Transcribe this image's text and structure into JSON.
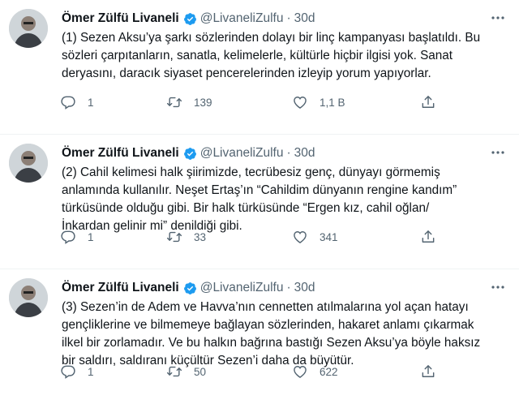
{
  "colors": {
    "verified": "#1d9bf0",
    "text": "#0f1419",
    "secondary": "#536471",
    "divider": "#eff3f4"
  },
  "icons": {
    "verified": "verified-badge-icon",
    "more": "more-horizontal-icon",
    "reply": "reply-icon",
    "retweet": "retweet-icon",
    "like": "heart-icon",
    "share": "share-icon"
  },
  "tweets": [
    {
      "author": "Ömer Zülfü Livaneli",
      "handle": "@LivaneliZulfu",
      "separator": "·",
      "time": "30d",
      "text": "(1) Sezen Aksu’ya şarkı sözlerinden dolayı bir linç kampanyası başlatıldı.  Bu\nsözleri çarpıtanların, sanatla, kelimelerle, kültürle hiçbir ilgisi yok. Sanat\nderyasını, daracık siyaset pencerelerinden izleyip yorum yapıyorlar.",
      "replies": "1",
      "retweets": "139",
      "likes": "1,1 B"
    },
    {
      "author": "Ömer Zülfü Livaneli",
      "handle": "@LivaneliZulfu",
      "separator": "·",
      "time": "30d",
      "text": "(2) Cahil kelimesi halk şiirimizde, tecrübesiz genç, dünyayı görmemiş\nanlamında kullanılır. Neşet Ertaş’ın “Cahildim dünyanın rengine kandım”\ntürküsünde olduğu gibi. Bir halk türküsünde “Ergen kız, cahil oğlan/\nİnkardan gelinir mi” denildiği gibi.",
      "replies": "1",
      "retweets": "33",
      "likes": "341"
    },
    {
      "author": "Ömer Zülfü Livaneli",
      "handle": "@LivaneliZulfu",
      "separator": "·",
      "time": "30d",
      "text": "(3) Sezen’in de Adem ve Havva’nın cennetten atılmalarına yol açan hatayı\ngençliklerine ve bilmemeye bağlayan sözlerinden, hakaret anlamı çıkarmak\nilkel bir zorlamadır. Ve bu halkın bağrına bastığı Sezen Aksu’ya böyle haksız\nbir saldırı, saldıranı küçültür Sezen’i daha da büyütür.",
      "replies": "1",
      "retweets": "50",
      "likes": "622"
    }
  ]
}
